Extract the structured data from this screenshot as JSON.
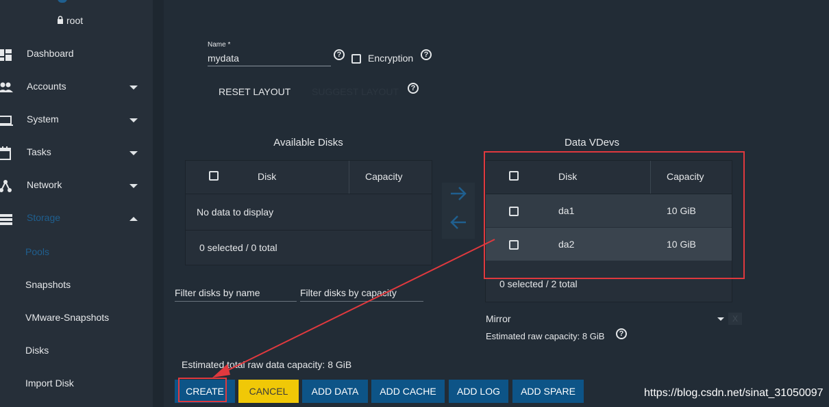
{
  "sidebar": {
    "user": "root",
    "items": [
      {
        "label": "Dashboard",
        "icon": "dashboard-icon",
        "expandable": false
      },
      {
        "label": "Accounts",
        "icon": "accounts-icon",
        "expandable": true
      },
      {
        "label": "System",
        "icon": "laptop-icon",
        "expandable": true
      },
      {
        "label": "Tasks",
        "icon": "calendar-icon",
        "expandable": true
      },
      {
        "label": "Network",
        "icon": "network-icon",
        "expandable": true
      },
      {
        "label": "Storage",
        "icon": "storage-icon",
        "expandable": true,
        "expanded": true,
        "active": true
      }
    ],
    "storage_sub": [
      "Pools",
      "Snapshots",
      "VMware-Snapshots",
      "Disks",
      "Import Disk"
    ],
    "active_sub": "Pools"
  },
  "form": {
    "name_label": "Name *",
    "name_value": "mydata",
    "encryption_label": "Encryption",
    "reset_layout": "RESET LAYOUT",
    "suggest_layout": "SUGGEST LAYOUT"
  },
  "available_disks": {
    "title": "Available Disks",
    "columns": [
      "Disk",
      "Capacity"
    ],
    "empty_text": "No data to display",
    "footer": "0 selected / 0 total"
  },
  "data_vdevs": {
    "title": "Data VDevs",
    "columns": [
      "Disk",
      "Capacity"
    ],
    "rows": [
      {
        "disk": "da1",
        "capacity": "10 GiB"
      },
      {
        "disk": "da2",
        "capacity": "10 GiB"
      }
    ],
    "footer": "0 selected / 2 total",
    "layout": "Mirror",
    "estimated": "Estimated raw capacity: 8 GiB"
  },
  "filters": {
    "by_name": "Filter disks by name",
    "by_capacity": "Filter disks by capacity"
  },
  "total_capacity": "Estimated total raw data capacity: 8 GiB",
  "buttons": {
    "create": "CREATE",
    "cancel": "CANCEL",
    "add_data": "ADD DATA",
    "add_cache": "ADD CACHE",
    "add_log": "ADD LOG",
    "add_spare": "ADD SPARE"
  },
  "watermark": "https://blog.csdn.net/sinat_31050097",
  "colors": {
    "accent_blue": "#0d5487",
    "cancel_yellow": "#f0c807",
    "annotation_red": "#e0393e",
    "active_nav": "#1f5f8f"
  }
}
